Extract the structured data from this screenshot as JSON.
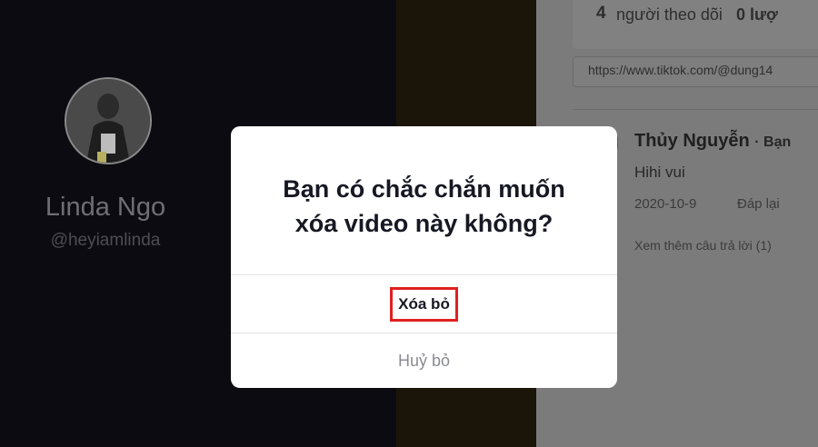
{
  "profile": {
    "name": "Linda Ngo",
    "handle": "@heyiamlinda"
  },
  "stats": {
    "followers_count": "4",
    "followers_label": "người theo dõi",
    "likes_partial": "0 lượ"
  },
  "share_url": "https://www.tiktok.com/@dung14",
  "comment": {
    "author": "Thủy Nguyễn",
    "author_suffix": "· Bạn",
    "text": "Hihi vui",
    "date": "2020-10-9",
    "reply_label": "Đáp lại",
    "more_replies": "Xem thêm câu trả lời (1)"
  },
  "modal": {
    "title_line1": "Bạn có chắc chắn muốn",
    "title_line2": "xóa video này không?",
    "delete_label": "Xóa bỏ",
    "cancel_label": "Huỷ bỏ",
    "highlight_color": "#e02020"
  }
}
